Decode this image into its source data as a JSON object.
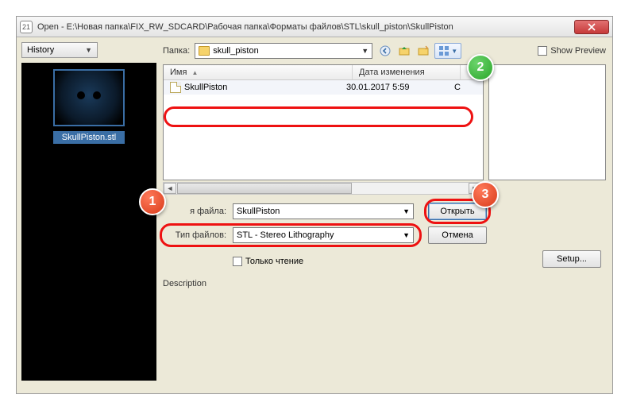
{
  "window": {
    "app_icon_text": "21",
    "title": "Open - E:\\Новая папка\\FIX_RW_SDCARD\\Рабочая папка\\Форматы файлов\\STL\\skull_piston\\SkullPiston"
  },
  "left": {
    "history_label": "History",
    "thumb_caption": "SkullPiston.stl"
  },
  "toprow": {
    "folder_label": "Папка:",
    "folder_value": "skull_piston",
    "show_preview_label": "Show Preview"
  },
  "columns": {
    "name": "Имя",
    "date": "Дата изменения",
    "type": ""
  },
  "file_row": {
    "name": "SkullPiston",
    "date": "30.01.2017 5:59",
    "type": "С"
  },
  "form": {
    "filename_label": "я файла:",
    "filename_value": "SkullPiston",
    "filetype_label": "Тип файлов:",
    "filetype_value": "STL  - Stereo Lithography",
    "readonly_label": "Только чтение",
    "desc_label": "Description"
  },
  "buttons": {
    "open": "Открыть",
    "cancel": "Отмена",
    "setup": "Setup..."
  },
  "callouts": {
    "one": "1",
    "two": "2",
    "three": "3"
  }
}
